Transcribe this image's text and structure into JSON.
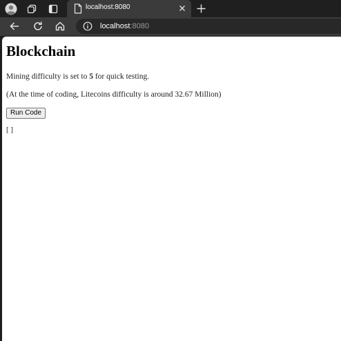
{
  "browser": {
    "tab": {
      "title": "localhost:8080",
      "close_glyph": "✕"
    },
    "new_tab_glyph": "+",
    "address": {
      "host": "localhost",
      "port": ":8080"
    }
  },
  "page": {
    "heading": "Blockchain",
    "difficulty_prefix": "Mining difficulty is set to ",
    "difficulty_value": "5",
    "difficulty_suffix": " for quick testing.",
    "note": "(At the time of coding, Litecoins difficulty is around 32.67 Million)",
    "run_button_label": "Run Code",
    "output": "[ ]"
  },
  "icons": {
    "profile": "profile-avatar-icon",
    "workspaces": "workspaces-icon",
    "vertical_tabs": "vertical-tabs-icon",
    "tab_favicon": "page-icon",
    "back": "back-arrow-icon",
    "reload": "reload-icon",
    "home": "home-icon",
    "site_info": "info-icon"
  }
}
